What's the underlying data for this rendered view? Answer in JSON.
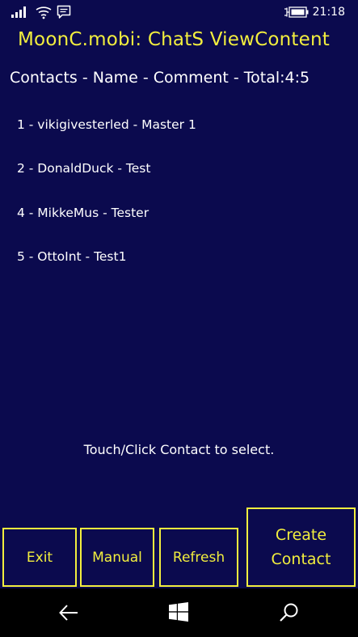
{
  "status_bar": {
    "time": "21:18",
    "icons": [
      "signal-icon",
      "wifi-icon",
      "message-icon",
      "battery-charging-icon"
    ]
  },
  "app": {
    "title": "MoonC.mobi: ChatS ViewContent",
    "subtitle": "Contacts - Name - Comment - Total:4:5"
  },
  "contacts": [
    "1 - vikigivesterled - Master 1",
    "2 - DonaldDuck - Test",
    "4 - MikkeMus - Tester",
    "5 - OttoInt - Test1"
  ],
  "hint": "Touch/Click Contact to select.",
  "buttons": {
    "exit": "Exit",
    "manual": "Manual",
    "refresh": "Refresh",
    "create": "Create Contact"
  },
  "nav_bar": {
    "icons": [
      "back-arrow-icon",
      "windows-start-icon",
      "search-icon"
    ]
  },
  "colors": {
    "background": "#0b0a4e",
    "accent": "#f2ee3e",
    "text": "#ffffff",
    "nav_bar": "#000000"
  }
}
